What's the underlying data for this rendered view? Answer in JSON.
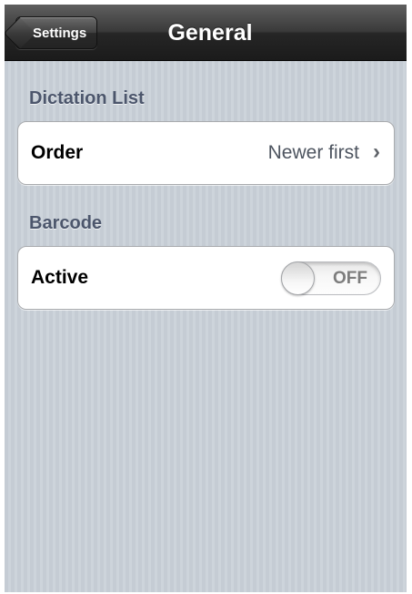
{
  "navbar": {
    "back_label": "Settings",
    "title": "General"
  },
  "sections": [
    {
      "header": "Dictation List",
      "row": {
        "label": "Order",
        "value": "Newer first",
        "accessory": "chevron-right-icon"
      }
    },
    {
      "header": "Barcode",
      "row": {
        "label": "Active",
        "toggle": {
          "state_label": "OFF",
          "on": false
        }
      }
    }
  ],
  "colors": {
    "section_header": "#4c566c",
    "value_text": "#4e5560"
  }
}
